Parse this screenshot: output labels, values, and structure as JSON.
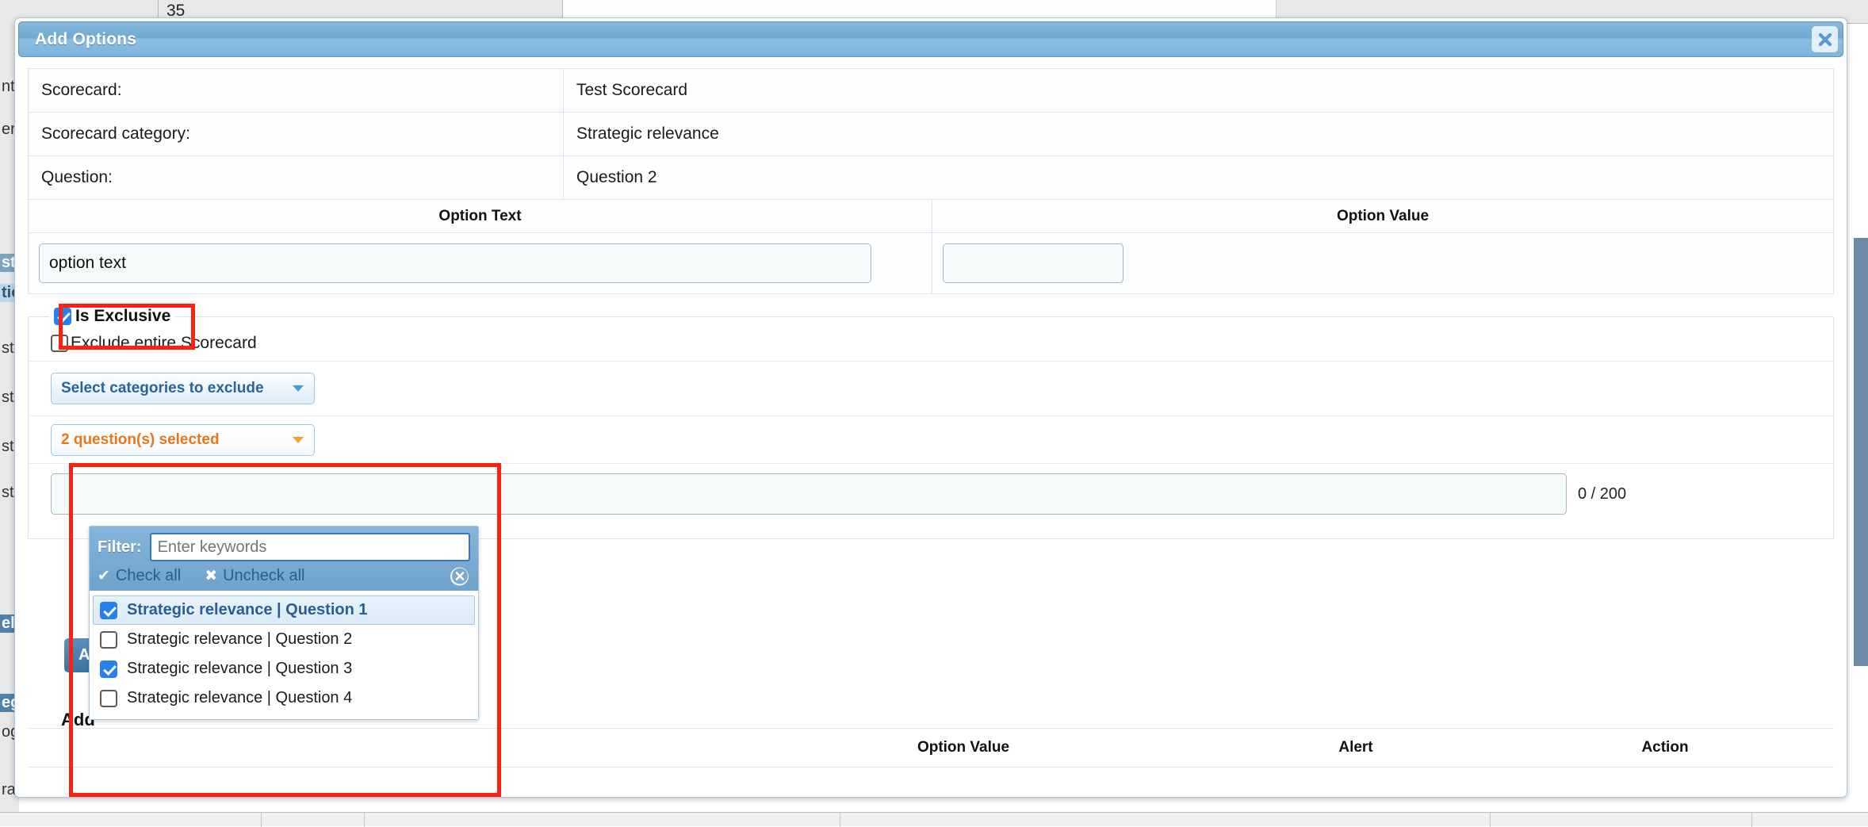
{
  "background": {
    "top_cells": [
      "",
      "35",
      ""
    ],
    "left_labels": [
      "nt",
      "er",
      "st",
      "tio",
      "stio",
      "stio",
      "stio",
      "stio",
      "ele",
      "eg",
      "ogi",
      "rai"
    ]
  },
  "modal": {
    "title": "Add Options",
    "close_icon": "close-icon",
    "info_rows": [
      {
        "label": "Scorecard:",
        "value": "Test Scorecard"
      },
      {
        "label": "Scorecard category:",
        "value": "Strategic relevance"
      },
      {
        "label": "Question:",
        "value": "Question 2"
      }
    ],
    "option_headers": {
      "text": "Option Text",
      "value": "Option Value"
    },
    "option_text_value": "option text",
    "option_text_placeholder": "",
    "option_value_value": "",
    "option_value_placeholder": "",
    "exclusive": {
      "legend_label": "Is Exclusive",
      "legend_checked": true,
      "exclude_entire_label": "Exclude entire Scorecard",
      "exclude_entire_checked": false,
      "categories_button_label": "Select categories to exclude",
      "questions_button_label": "2 question(s) selected",
      "note_count": "0 / 200",
      "note_value": "",
      "note_placeholder": ""
    },
    "questions_dropdown": {
      "filter_label": "Filter:",
      "filter_placeholder": "Enter keywords",
      "filter_value": "",
      "check_all_label": "Check all",
      "uncheck_all_label": "Uncheck all",
      "check_icon": "check-icon",
      "uncheck_icon": "cross-icon",
      "clear_icon": "clear-circle-icon",
      "items": [
        {
          "label": "Strategic relevance | Question 1",
          "checked": true,
          "highlighted": true
        },
        {
          "label": "Strategic relevance | Question 2",
          "checked": false,
          "highlighted": false
        },
        {
          "label": "Strategic relevance | Question 3",
          "checked": true,
          "highlighted": false
        },
        {
          "label": "Strategic relevance | Question 4",
          "checked": false,
          "highlighted": false
        }
      ]
    },
    "add_button_label": "A",
    "add_section_label": "Add",
    "lower_table_headers": [
      "",
      "Option Value",
      "Alert",
      "Action"
    ]
  },
  "colors": {
    "accent_blue": "#6fa9d2",
    "annotation_red": "#fe2112",
    "orange_text": "#e8761b",
    "link_blue": "#2a6496"
  }
}
